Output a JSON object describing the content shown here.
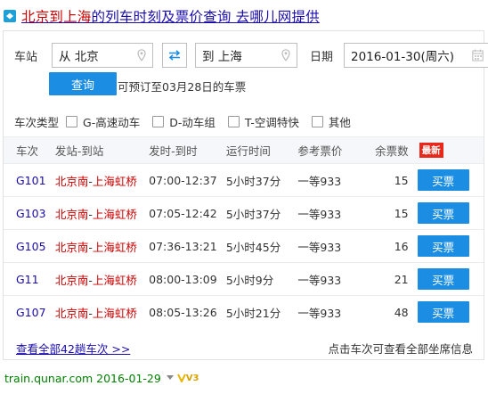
{
  "title": {
    "hl1": "北京到上海",
    "rest": "的列车时刻及票价查询 去哪儿网提供"
  },
  "search": {
    "station_label": "车站",
    "from_value": "从 北京",
    "to_value": "到 上海",
    "date_label": "日期",
    "date_value": "2016-01-30(周六)",
    "query_label": "查询",
    "presale_text": "可预订至03月28日的车票"
  },
  "filters": {
    "label": "车次类型",
    "options": [
      "G-高速动车",
      "D-动车组",
      "T-空调特快",
      "其他"
    ]
  },
  "table": {
    "headers": [
      "车次",
      "发站-到站",
      "发时-到时",
      "运行时间",
      "参考票价",
      "余票数"
    ],
    "new_badge": "最新",
    "buy_label": "买票",
    "rows": [
      {
        "train": "G101",
        "from": "北京南",
        "sep": "-",
        "to": "上海虹桥",
        "time": "07:00-12:37",
        "duration": "5小时37分",
        "price": "一等933",
        "left": "15"
      },
      {
        "train": "G103",
        "from": "北京南",
        "sep": "-",
        "to": "上海虹桥",
        "time": "07:05-12:42",
        "duration": "5小时37分",
        "price": "一等933",
        "left": "15"
      },
      {
        "train": "G105",
        "from": "北京南",
        "sep": "-",
        "to": "上海虹桥",
        "time": "07:36-13:21",
        "duration": "5小时45分",
        "price": "一等933",
        "left": "16"
      },
      {
        "train": "G11",
        "from": "北京南",
        "sep": "-",
        "to": "上海虹桥",
        "time": "08:00-13:09",
        "duration": "5小时9分",
        "price": "一等933",
        "left": "21"
      },
      {
        "train": "G107",
        "from": "北京南",
        "sep": "-",
        "to": "上海虹桥",
        "time": "08:05-13:26",
        "duration": "5小时21分",
        "price": "一等933",
        "left": "48"
      }
    ]
  },
  "more_link": "查看全部42趟车次 >>",
  "hint": "点击车次可查看全部坐席信息",
  "footer": {
    "url": "train.qunar.com 2016-01-29",
    "badge": "V3"
  },
  "colors": {
    "accent": "#1b8de3",
    "link": "#1a0dab",
    "highlight": "#cc0000",
    "url": "#008000"
  }
}
